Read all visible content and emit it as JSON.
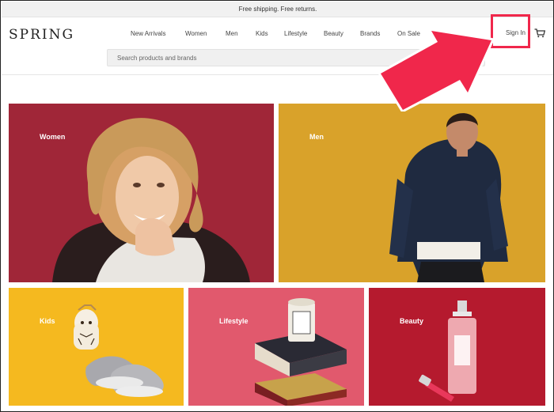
{
  "promo": {
    "text": "Free shipping. Free returns."
  },
  "brand": {
    "logo": "SPRING"
  },
  "nav": {
    "items": [
      {
        "label": "New Arrivals"
      },
      {
        "label": "Women"
      },
      {
        "label": "Men"
      },
      {
        "label": "Kids"
      },
      {
        "label": "Lifestyle"
      },
      {
        "label": "Beauty"
      },
      {
        "label": "Brands"
      },
      {
        "label": "On Sale"
      }
    ]
  },
  "header": {
    "signin_label": "Sign In",
    "cart_icon": "cart-icon"
  },
  "search": {
    "placeholder": "Search products and brands",
    "value": ""
  },
  "tiles": [
    {
      "label": "Women",
      "color": "#a6283b"
    },
    {
      "label": "Men",
      "color": "#d9a22a"
    },
    {
      "label": "Kids",
      "color": "#f5b91f"
    },
    {
      "label": "Lifestyle",
      "color": "#e1596d"
    },
    {
      "label": "Beauty",
      "color": "#b51a2e"
    }
  ],
  "annotation": {
    "highlight_color": "#f0274b"
  }
}
